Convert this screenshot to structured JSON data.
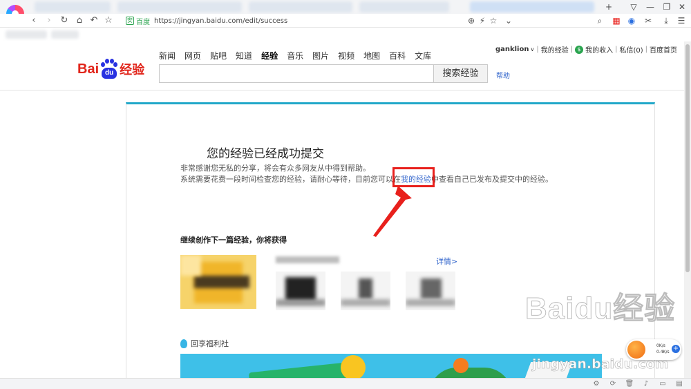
{
  "browser": {
    "url": "https://jingyan.baidu.com/edit/success",
    "secure_label": "百度",
    "secure_icon": "安",
    "icons": [
      "back-icon",
      "forward-icon",
      "reload-icon",
      "home-icon",
      "undo-icon",
      "star-icon",
      "zoom-icon",
      "lightning-icon",
      "bookmark-star-icon",
      "dropdown-icon",
      "search-icon",
      "apps-icon",
      "comment-icon",
      "scissors-icon",
      "download-icon",
      "menu-icon"
    ],
    "window_controls": {
      "pin": "▽",
      "minimize": "—",
      "restore": "❐",
      "close": "✕",
      "new_tab": "+"
    }
  },
  "header": {
    "logo": {
      "bai": "Bai",
      "du": "du",
      "jingyan": "经验"
    },
    "nav": [
      "新闻",
      "网页",
      "贴吧",
      "知道",
      "经验",
      "音乐",
      "图片",
      "视频",
      "地图",
      "百科",
      "文库"
    ],
    "nav_active_index": 4,
    "search_button": "搜索经验",
    "help": "帮助",
    "user": {
      "name": "ganklion",
      "caret": "∨",
      "my_experience": "我的经验",
      "income_icon": "$",
      "my_income": "我的收入",
      "messages": "私信(0)",
      "home": "百度首页",
      "separator": "|"
    }
  },
  "main": {
    "title": "您的经验已经成功提交",
    "line1": "非常感谢您无私的分享，将会有众多网友从中得到帮助。",
    "line2_before": "系统需要花费一段时间检查您的经验，请耐心等待，目前您可以在",
    "line2_link": "我的经验",
    "line2_after": "中查看自己已发布及提交中的经验。",
    "continue_title": "继续创作下一篇经验，你将获得",
    "details": "详情>",
    "welfare": "回享福利社"
  },
  "watermark": {
    "brand": "Baidu经验",
    "url": "jingyan.baidu.com"
  },
  "speed_widget": {
    "up": "0K/s",
    "down": "0.4K/s",
    "plus": "+"
  },
  "colors": {
    "accent": "#21a8c9",
    "link": "#3366cc",
    "brand_red": "#e1251b",
    "brand_blue": "#2932e1",
    "highlight": "#e8201c"
  }
}
